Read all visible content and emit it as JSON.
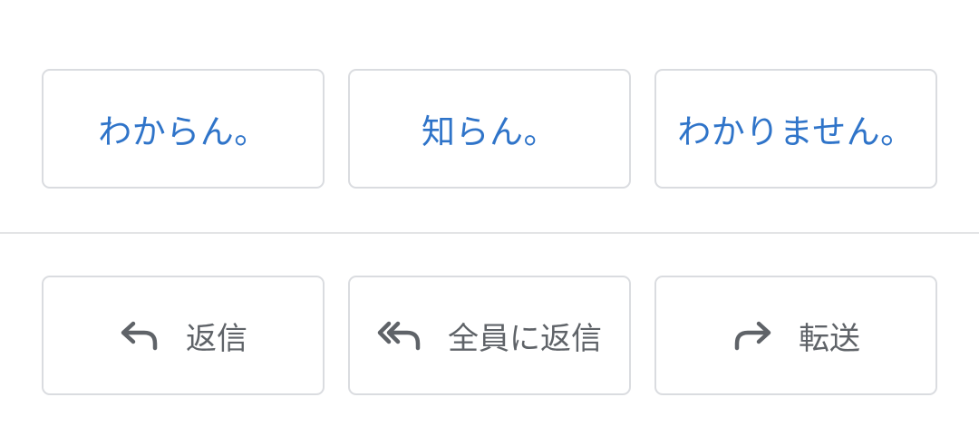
{
  "smart_replies": [
    {
      "label": "わからん。"
    },
    {
      "label": "知らん。"
    },
    {
      "label": "わかりません。"
    }
  ],
  "actions": {
    "reply": {
      "label": "返信",
      "icon": "reply-icon"
    },
    "reply_all": {
      "label": "全員に返信",
      "icon": "reply-all-icon"
    },
    "forward": {
      "label": "転送",
      "icon": "forward-icon"
    }
  },
  "colors": {
    "smart_reply_text": "#2f74c9",
    "action_text": "#5f6368",
    "border": "#dadce0"
  }
}
